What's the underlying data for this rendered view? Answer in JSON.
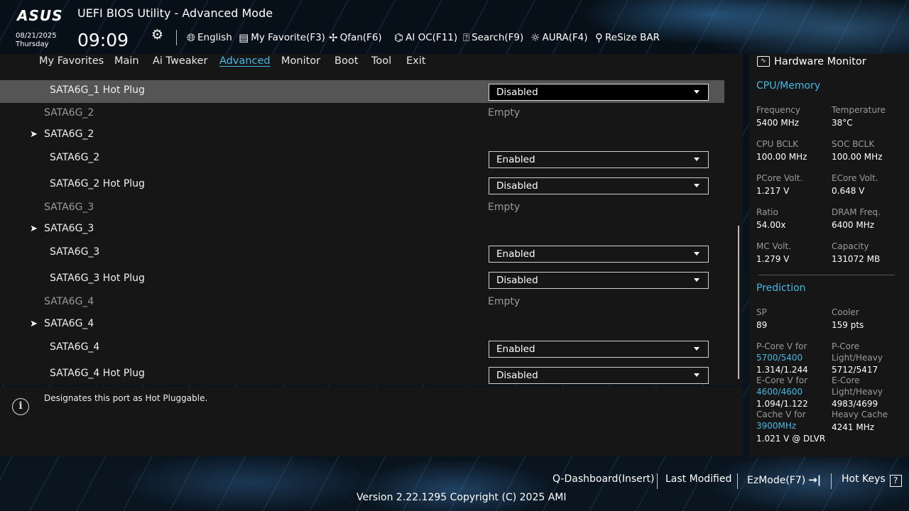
{
  "header": {
    "logo": "ASUS",
    "title": "UEFI BIOS Utility - Advanced Mode",
    "date": "08/21/2025",
    "day": "Thursday",
    "time": "09:09",
    "tools": [
      {
        "icon": "globe-icon",
        "label": "English"
      },
      {
        "icon": "favorite-icon",
        "label": "My Favorite(F3)"
      },
      {
        "icon": "fan-icon",
        "label": "Qfan(F6)"
      },
      {
        "icon": "ai-oc-icon",
        "label": "AI OC(F11)"
      },
      {
        "icon": "search-icon",
        "label": "Search(F9)"
      },
      {
        "icon": "aura-icon",
        "label": "AURA(F4)"
      },
      {
        "icon": "resize-bar-icon",
        "label": "ReSize BAR"
      }
    ]
  },
  "tabs": [
    "My Favorites",
    "Main",
    "Ai Tweaker",
    "Advanced",
    "Monitor",
    "Boot",
    "Tool",
    "Exit"
  ],
  "active_tab": "Advanced",
  "rows": [
    {
      "label": "SATA6G_1 Hot Plug",
      "value": "Disabled"
    },
    {
      "label": "SATA6G_2",
      "value": "Empty"
    },
    {
      "label": "SATA6G_2"
    },
    {
      "label": "SATA6G_2",
      "value": "Enabled"
    },
    {
      "label": "SATA6G_2 Hot Plug",
      "value": "Disabled"
    },
    {
      "label": "SATA6G_3",
      "value": "Empty"
    },
    {
      "label": "SATA6G_3"
    },
    {
      "label": "SATA6G_3",
      "value": "Enabled"
    },
    {
      "label": "SATA6G_3 Hot Plug",
      "value": "Disabled"
    },
    {
      "label": "SATA6G_4",
      "value": "Empty"
    },
    {
      "label": "SATA6G_4"
    },
    {
      "label": "SATA6G_4",
      "value": "Enabled"
    },
    {
      "label": "SATA6G_4 Hot Plug",
      "value": "Disabled"
    }
  ],
  "help": {
    "text": "Designates this port as Hot Pluggable."
  },
  "hw": {
    "title": "Hardware Monitor",
    "cpu_section": "CPU/Memory",
    "cpu": [
      {
        "k": "Frequency",
        "v": "5400 MHz"
      },
      {
        "k": "Temperature",
        "v": "38°C"
      },
      {
        "k": "CPU BCLK",
        "v": "100.00 MHz"
      },
      {
        "k": "SOC BCLK",
        "v": "100.00 MHz"
      },
      {
        "k": "PCore Volt.",
        "v": "1.217 V"
      },
      {
        "k": "ECore Volt.",
        "v": "0.648 V"
      },
      {
        "k": "Ratio",
        "v": "54.00x"
      },
      {
        "k": "DRAM Freq.",
        "v": "6400 MHz"
      },
      {
        "k": "MC Volt.",
        "v": "1.279 V"
      },
      {
        "k": "Capacity",
        "v": "131072 MB"
      }
    ],
    "pred_section": "Prediction",
    "sp_k": "SP",
    "sp_v": "89",
    "cooler_k": "Cooler",
    "cooler_v": "159 pts",
    "pcore_k": "P-Core V for",
    "pcore_f": "5700/5400",
    "pcore_v": "1.314/1.244",
    "plh_k1": "P-Core",
    "plh_k2": "Light/Heavy",
    "plh_v": "5712/5417",
    "ecore_k": "E-Core V for",
    "ecore_f": "4600/4600",
    "ecore_v": "1.094/1.122",
    "elh_k1": "E-Core",
    "elh_k2": "Light/Heavy",
    "elh_v": "4983/4699",
    "cache_k": "Cache V for",
    "cache_f": "3900MHz",
    "cache_v": "1.021 V @ DLVR",
    "hc_k": "Heavy Cache",
    "hc_v": "4241 MHz"
  },
  "footer": {
    "qdash": "Q-Dashboard(Insert)",
    "last": "Last Modified",
    "ez": "EzMode(F7)",
    "hot": "Hot Keys",
    "hot_icon": "?",
    "version": "Version 2.22.1295 Copyright (C) 2025 AMI"
  }
}
